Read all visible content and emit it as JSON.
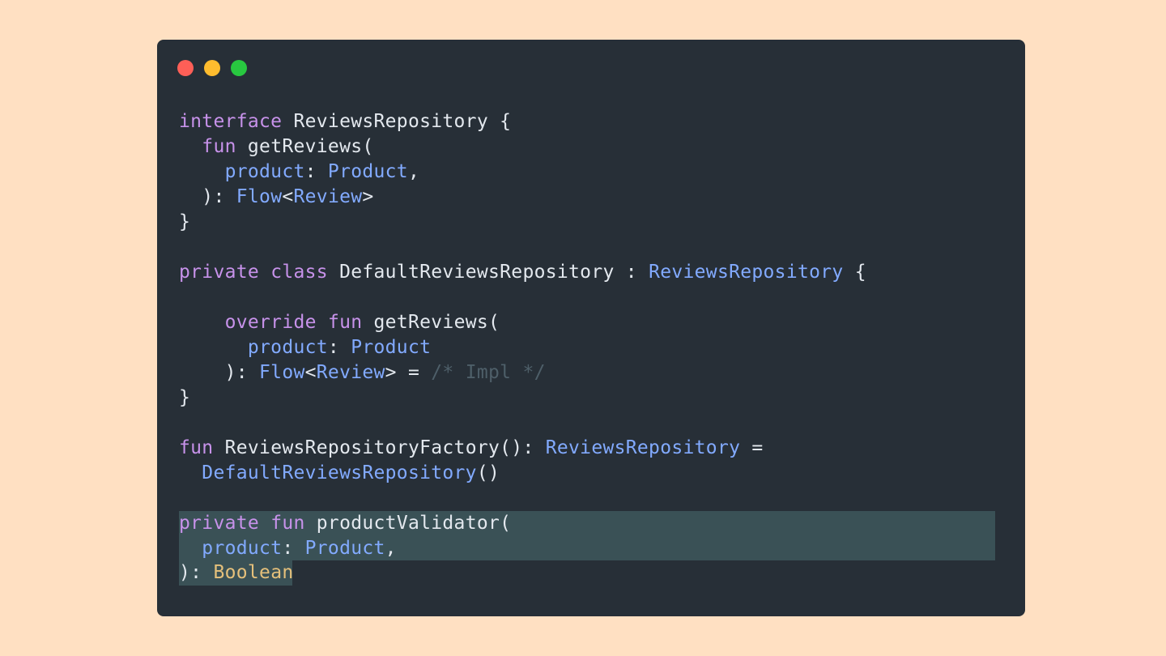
{
  "theme": {
    "background": "#FFE0C2",
    "window": "#272F37",
    "selection": "#3A5156",
    "dot_close": "#FE5F57",
    "dot_minimize": "#FEBC2E",
    "dot_maximize": "#28C840",
    "colors": {
      "kw": "#C792EA",
      "type": "#82AAFF",
      "plain": "#E3E8EE",
      "comment": "#4E5F69",
      "builtin": "#E5C07B"
    }
  },
  "window_controls": [
    "close-dot",
    "minimize-dot",
    "maximize-dot"
  ],
  "code": {
    "language": "kotlin",
    "lines": [
      [
        [
          "kw",
          "interface"
        ],
        [
          "plain",
          " ReviewsRepository {"
        ]
      ],
      [
        [
          "plain",
          "  "
        ],
        [
          "kw",
          "fun"
        ],
        [
          "plain",
          " getReviews("
        ]
      ],
      [
        [
          "plain",
          "    "
        ],
        [
          "type",
          "product"
        ],
        [
          "plain",
          ": "
        ],
        [
          "type",
          "Product"
        ],
        [
          "plain",
          ","
        ]
      ],
      [
        [
          "plain",
          "  ): "
        ],
        [
          "type",
          "Flow"
        ],
        [
          "plain",
          "<"
        ],
        [
          "type",
          "Review"
        ],
        [
          "plain",
          ">"
        ]
      ],
      [
        [
          "plain",
          "}"
        ]
      ],
      [],
      [
        [
          "kw",
          "private"
        ],
        [
          "plain",
          " "
        ],
        [
          "kw",
          "class"
        ],
        [
          "plain",
          " DefaultReviewsRepository : "
        ],
        [
          "type",
          "ReviewsRepository"
        ],
        [
          "plain",
          " {"
        ]
      ],
      [],
      [
        [
          "plain",
          "    "
        ],
        [
          "kw",
          "override"
        ],
        [
          "plain",
          " "
        ],
        [
          "kw",
          "fun"
        ],
        [
          "plain",
          " getReviews("
        ]
      ],
      [
        [
          "plain",
          "      "
        ],
        [
          "type",
          "product"
        ],
        [
          "plain",
          ": "
        ],
        [
          "type",
          "Product"
        ]
      ],
      [
        [
          "plain",
          "    ): "
        ],
        [
          "type",
          "Flow"
        ],
        [
          "plain",
          "<"
        ],
        [
          "type",
          "Review"
        ],
        [
          "plain",
          "> = "
        ],
        [
          "comment",
          "/* Impl */"
        ]
      ],
      [
        [
          "plain",
          "}"
        ]
      ],
      [],
      [
        [
          "kw",
          "fun"
        ],
        [
          "plain",
          " ReviewsRepositoryFactory(): "
        ],
        [
          "type",
          "ReviewsRepository"
        ],
        [
          "plain",
          " ="
        ]
      ],
      [
        [
          "plain",
          "  "
        ],
        [
          "type",
          "DefaultReviewsRepository"
        ],
        [
          "plain",
          "()"
        ]
      ],
      [],
      [
        [
          "kw",
          "private"
        ],
        [
          "plain",
          " "
        ],
        [
          "kw",
          "fun"
        ],
        [
          "plain",
          " productValidator("
        ]
      ],
      [
        [
          "plain",
          "  "
        ],
        [
          "type",
          "product"
        ],
        [
          "plain",
          ": "
        ],
        [
          "type",
          "Product"
        ],
        [
          "plain",
          ","
        ]
      ],
      [
        [
          "plain",
          "): "
        ],
        [
          "builtin",
          "Boolean"
        ]
      ]
    ]
  }
}
